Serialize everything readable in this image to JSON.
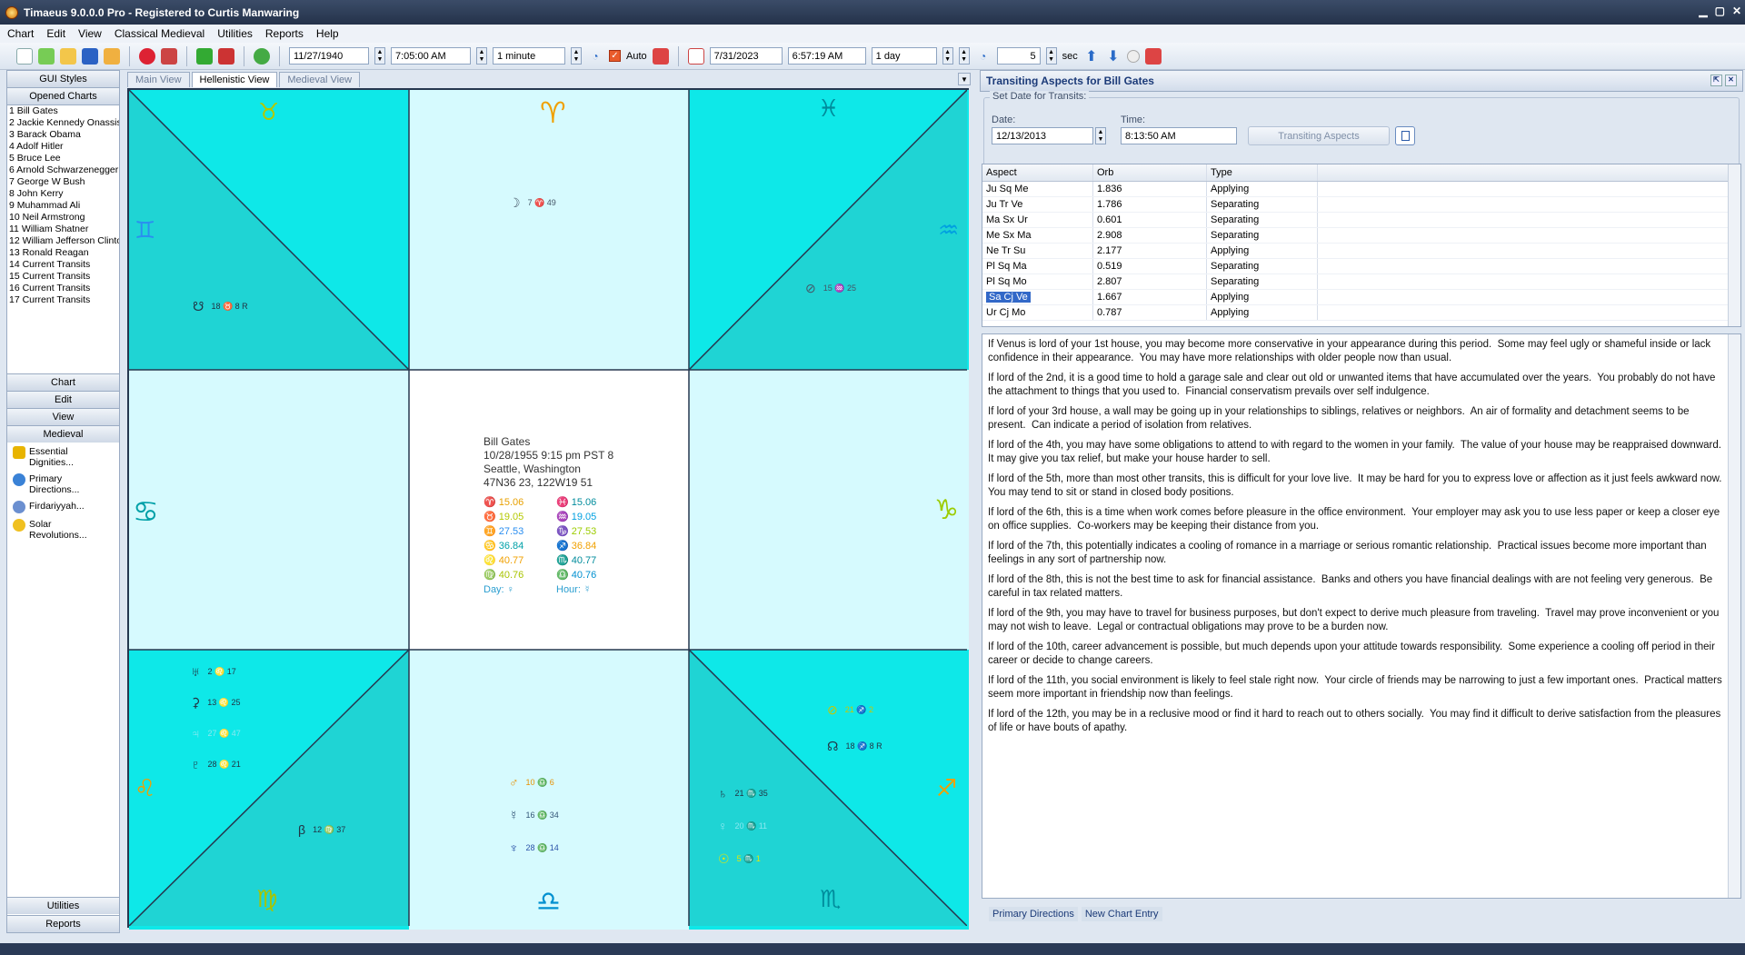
{
  "window": {
    "title": "Timaeus 9.0.0.0 Pro - Registered to Curtis Manwaring",
    "min": "▁",
    "max": "▢",
    "close": "✕"
  },
  "menu": [
    "Chart",
    "Edit",
    "View",
    "Classical Medieval",
    "Utilities",
    "Reports",
    "Help"
  ],
  "toolbar": {
    "date1": "11/27/1940",
    "time1": "7:05:00 AM",
    "step1": "1 minute",
    "auto": "Auto",
    "date2": "7/31/2023",
    "time2": "6:57:19 AM",
    "step2": "1 day",
    "count": "5",
    "sec": "sec"
  },
  "left": {
    "gui_styles": "GUI Styles",
    "opened_charts": "Opened Charts",
    "charts": [
      "1 Bill Gates",
      "2 Jackie Kennedy Onassis",
      "3 Barack Obama",
      "4 Adolf Hitler",
      "5 Bruce Lee",
      "6 Arnold Schwarzenegger",
      "7 George W Bush",
      "8 John Kerry",
      "9 Muhammad Ali",
      "10 Neil Armstrong",
      "11 William Shatner",
      "12 William Jefferson Clinton",
      "13 Ronald Reagan",
      "14 Current Transits",
      "15 Current Transits",
      "16 Current Transits",
      "17 Current Transits"
    ],
    "nav": [
      "Chart",
      "Edit",
      "View",
      "Medieval"
    ],
    "medieval": [
      {
        "l1": "Essential",
        "l2": "Dignities...",
        "icon": "crown-icon",
        "color": "#e8b400"
      },
      {
        "l1": "Primary",
        "l2": "Directions...",
        "icon": "globe-icon",
        "color": "#3a82d6"
      },
      {
        "l1": "Firdariyyah...",
        "l2": "",
        "icon": "clock-icon",
        "color": "#6b8fd0"
      },
      {
        "l1": "Solar",
        "l2": "Revolutions...",
        "icon": "sun-icon",
        "color": "#f0c020"
      }
    ],
    "utilities": "Utilities",
    "reports": "Reports"
  },
  "tabs": [
    "Main View",
    "Hellenistic View",
    "Medieval View"
  ],
  "chart": {
    "signs": {
      "top_left": "♉",
      "top_mid": "♈",
      "top_right": "♓",
      "mid_left_top": "♊",
      "mid_right_top": "♒",
      "mid_left": "♋",
      "mid_right": "♑",
      "bot_left_top": "♌",
      "bot_right_top": "♐",
      "bot_left": "♍",
      "bot_mid": "♎",
      "bot_right": "♏"
    },
    "planets": {
      "moon": "7 ♈ 49",
      "node_s": "18 ♉ 8 R",
      "moon_t": "15 ♒ 25",
      "uranus": "2 ♌ 17",
      "ceres": "13 ♌ 25",
      "jupiter": "27 ♌ 47",
      "pluto": "28 ♌ 21",
      "vesta": "12 ♍ 37",
      "mars": "10 ♎ 6",
      "mercury": "16 ♎ 34",
      "neptune": "28 ♎ 14",
      "fortune": "21 ♐ 2",
      "node_n": "18 ♐ 8 R",
      "saturn": "21 ♏ 35",
      "venus": "20 ♏ 11",
      "sun": "5 ♏ 1"
    },
    "native": {
      "name": "Bill Gates",
      "date": "10/28/1955  9:15 pm  PST 8",
      "place": "Seattle, Washington",
      "coords": "47N36 23,  122W19 51"
    },
    "lots": [
      [
        "♈  15.06",
        "♓  15.06"
      ],
      [
        "♉  19.05",
        "♒  19.05"
      ],
      [
        "♊  27.53",
        "♑  27.53"
      ],
      [
        "♋  36.84",
        "♐  36.84"
      ],
      [
        "♌  40.77",
        "♏  40.77"
      ],
      [
        "♍  40.76",
        "♎  40.76"
      ]
    ],
    "day": "Day:     ♀",
    "hour": "Hour:   ☿"
  },
  "right": {
    "header": "Transiting Aspects for Bill Gates",
    "group": "Set Date for Transits:",
    "date_label": "Date:",
    "time_label": "Time:",
    "date": "12/13/2013",
    "time": "8:13:50 AM",
    "button": "Transiting Aspects",
    "cols": [
      "Aspect",
      "Orb",
      "Type"
    ],
    "rows": [
      [
        "Ju Sq Me",
        "1.836",
        "Applying"
      ],
      [
        "Ju Tr Ve",
        "1.786",
        "Separating"
      ],
      [
        "Ma Sx Ur",
        "0.601",
        "Separating"
      ],
      [
        "Me Sx Ma",
        "2.908",
        "Separating"
      ],
      [
        "Ne Tr Su",
        "2.177",
        "Applying"
      ],
      [
        "Pl Sq Ma",
        "0.519",
        "Separating"
      ],
      [
        "Pl Sq Mo",
        "2.807",
        "Separating"
      ],
      [
        "Sa Cj Ve",
        "1.667",
        "Applying"
      ],
      [
        "Ur Cj Mo",
        "0.787",
        "Applying"
      ]
    ],
    "text": [
      "If Venus is lord of your 1st house, you may become more conservative in your appearance during this period.  Some may feel ugly or shameful inside or lack confidence in their appearance.  You may have more relationships with older people now than usual.",
      "If lord of the 2nd, it is a good time to hold a garage sale and clear out old or unwanted items that have accumulated over the years.  You probably do not have the attachment to things that you used to.  Financial conservatism prevails over self indulgence.",
      "If lord of your 3rd house, a wall may be going up in your relationships to siblings, relatives or neighbors.  An air of formality and detachment seems to be present.  Can indicate a period of isolation from relatives.",
      "If lord of the 4th, you may have some obligations to attend to with regard to the women in your family.  The value of your house may be reappraised downward.  It may give you tax relief, but make your house harder to sell.",
      "If lord of the 5th, more than most other transits, this is difficult for your love live.  It may be hard for you to express love or affection as it just feels awkward now.  You may tend to sit or stand in closed body positions.",
      "If lord of the 6th, this is a time when work comes before pleasure in the office environment.  Your employer may ask you to use less paper or keep a closer eye on office supplies.  Co-workers may be keeping their distance from you.",
      "If lord of the 7th, this potentially indicates a cooling of romance in a marriage or serious romantic relationship.  Practical issues become more important than feelings in any sort of partnership now.",
      "If lord of the 8th, this is not the best time to ask for financial assistance.  Banks and others you have financial dealings with are not feeling very generous.  Be careful in tax related matters.",
      "If lord of the 9th, you may have to travel for business purposes, but don't expect to derive much pleasure from traveling.  Travel may prove inconvenient or you may not wish to leave.  Legal or contractual obligations may prove to be a burden now.",
      "If lord of the 10th, career advancement is possible, but much depends upon your attitude towards responsibility.  Some experience a cooling off period in their career or decide to change careers.",
      "If lord of the 11th, you social environment is likely to feel stale right now.  Your circle of friends may be narrowing to just a few important ones.  Practical matters seem more important in friendship now than feelings.",
      "If lord of the 12th, you may be in a reclusive mood or find it hard to reach out to others socially.  You may find it difficult to derive satisfaction from the pleasures of life or have bouts of apathy."
    ],
    "bottom_tabs": [
      "Primary Directions",
      "New Chart Entry"
    ]
  }
}
